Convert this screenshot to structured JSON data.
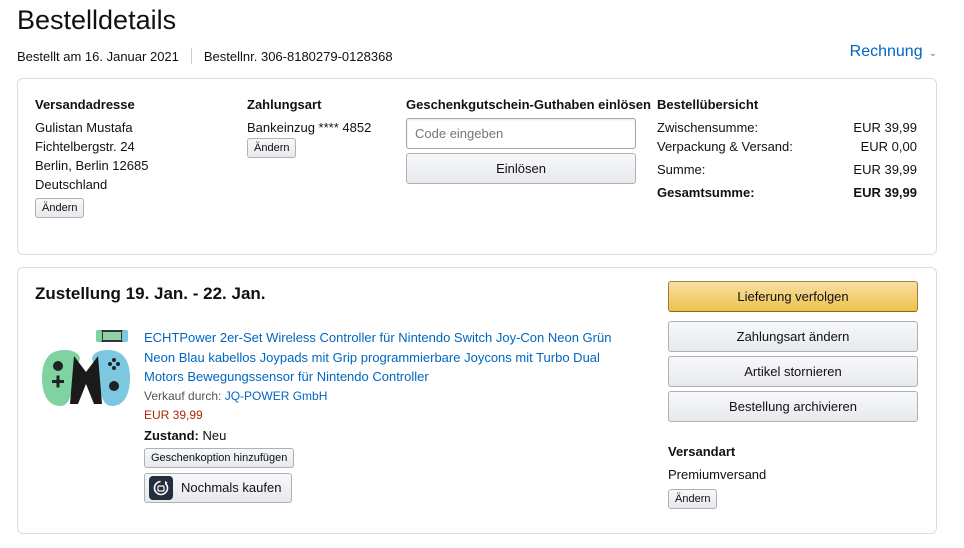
{
  "page": {
    "title": "Bestelldetails",
    "ordered_on": "Bestellt am 16. Januar 2021",
    "order_number": "Bestellnr. 306-8180279-0128368",
    "invoice_label": "Rechnung"
  },
  "address": {
    "heading": "Versandadresse",
    "name": "Gulistan Mustafa",
    "street": "Fichtelbergstr. 24",
    "city": "Berlin, Berlin 12685",
    "country": "Deutschland",
    "change_label": "Ändern"
  },
  "payment": {
    "heading": "Zahlungsart",
    "method": "Bankeinzug **** 4852",
    "change_label": "Ändern"
  },
  "giftcard": {
    "heading": "Geschenkgutschein-Guthaben einlösen",
    "placeholder": "Code eingeben",
    "redeem_label": "Einlösen"
  },
  "summary": {
    "heading": "Bestellübersicht",
    "rows": [
      {
        "label": "Zwischensumme:",
        "value": "EUR 39,99"
      },
      {
        "label": "Verpackung & Versand:",
        "value": "EUR 0,00"
      },
      {
        "label": "Summe:",
        "value": "EUR 39,99"
      }
    ],
    "total": {
      "label": "Gesamtsumme:",
      "value": "EUR 39,99"
    }
  },
  "shipment": {
    "delivery": "Zustellung 19. Jan. - 22. Jan.",
    "product": {
      "title": "ECHTPower 2er-Set Wireless Controller für Nintendo Switch Joy-Con Neon Grün Neon Blau kabellos Joypads mit Grip programmierbare Joycons mit Turbo Dual Motors Bewegungssensor für Nintendo Controller",
      "seller_label": "Verkauf durch: ",
      "seller": "JQ-POWER GmbH",
      "price": "EUR 39,99",
      "condition_label": "Zustand:",
      "condition": " Neu",
      "gift_label": "Geschenkoption hinzufügen",
      "buy_again_label": "Nochmals kaufen"
    },
    "actions": {
      "track": "Lieferung verfolgen",
      "change_payment": "Zahlungsart ändern",
      "cancel": "Artikel stornieren",
      "archive": "Bestellung archivieren"
    },
    "shipping": {
      "heading": "Versandart",
      "method": "Premiumversand",
      "change_label": "Ändern"
    }
  },
  "colors": {
    "link": "#0066c0",
    "price": "#b12704",
    "primary_button": "#f0c14b",
    "joycon_green": "#7ed3a0",
    "joycon_blue": "#7cc8e0"
  }
}
